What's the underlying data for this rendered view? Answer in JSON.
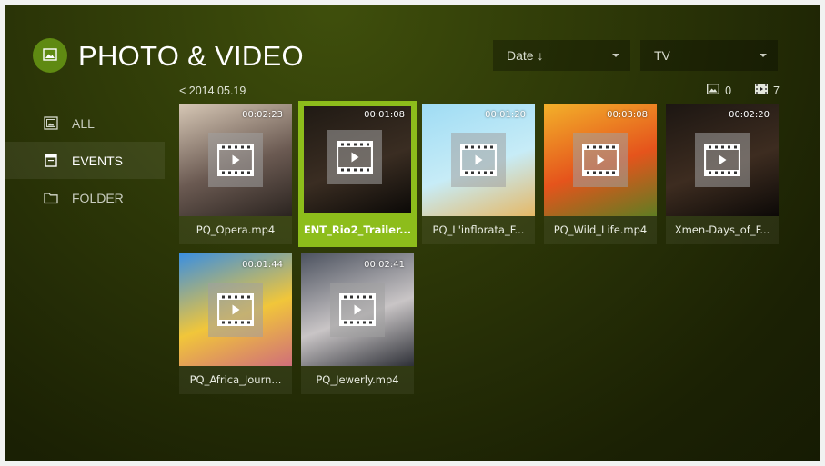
{
  "header": {
    "title": "PHOTO & VIDEO",
    "logo_icon": "image-icon"
  },
  "sort_dropdown": {
    "value": "Date ↓"
  },
  "device_dropdown": {
    "value": "TV"
  },
  "breadcrumb": "< 2014.05.19",
  "counts": {
    "photos": "0",
    "videos": "7"
  },
  "sidebar": {
    "items": [
      {
        "label": "ALL",
        "icon": "image-gallery-icon",
        "active": false
      },
      {
        "label": "EVENTS",
        "icon": "calendar-icon",
        "active": true
      },
      {
        "label": "FOLDER",
        "icon": "folder-icon",
        "active": false
      }
    ]
  },
  "videos": [
    {
      "name": "PQ_Opera.mp4",
      "duration": "00:02:23",
      "selected": false,
      "colors": [
        "#d6c7b5",
        "#6b5a52",
        "#2b2420"
      ]
    },
    {
      "name": "ENT_Rio2_Trailer...",
      "duration": "00:01:08",
      "selected": true,
      "colors": [
        "#201a14",
        "#3a2d22",
        "#0b0907"
      ]
    },
    {
      "name": "PQ_L'inflorata_F...",
      "duration": "00:01:20",
      "selected": false,
      "colors": [
        "#9fdcf4",
        "#c7ecf7",
        "#e5b866"
      ]
    },
    {
      "name": "PQ_Wild_Life.mp4",
      "duration": "00:03:08",
      "selected": false,
      "colors": [
        "#f3b12a",
        "#e5541c",
        "#5f7d22"
      ]
    },
    {
      "name": "Xmen-Days_of_F...",
      "duration": "00:02:20",
      "selected": false,
      "colors": [
        "#1c1612",
        "#3d2c20",
        "#0c0907"
      ]
    },
    {
      "name": "PQ_Africa_Journ...",
      "duration": "00:01:44",
      "selected": false,
      "colors": [
        "#3b8fe0",
        "#f1c63a",
        "#d06e7a"
      ]
    },
    {
      "name": "PQ_Jewerly.mp4",
      "duration": "00:02:41",
      "selected": false,
      "colors": [
        "#4d5360",
        "#c9c5c6",
        "#2e3037"
      ]
    }
  ],
  "colors": {
    "accent": "#8dbd1b",
    "logo_bg": "#5f8a12"
  }
}
